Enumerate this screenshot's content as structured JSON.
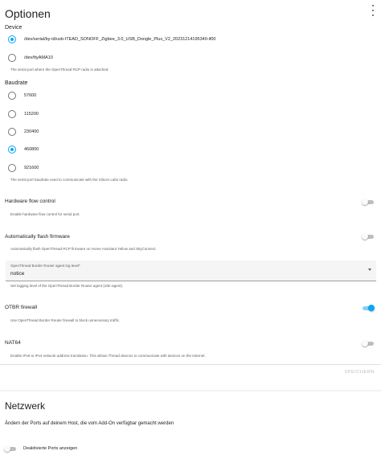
{
  "options_card": {
    "title": "Optionen",
    "device": {
      "label": "Device",
      "options": [
        {
          "label": "/dev/serial/by-id/usb-ITEAD_SONOFF_Zigbee_3.0_USB_Dongle_Plus_V2_20231214195340-if00",
          "selected": true
        },
        {
          "label": "/dev/ttyAMA10",
          "selected": false
        }
      ],
      "helper": "The serial port where the OpenThread RCP radio is attached."
    },
    "baudrate": {
      "label": "Baudrate",
      "options": [
        {
          "label": "57600",
          "selected": false
        },
        {
          "label": "115200",
          "selected": false
        },
        {
          "label": "230400",
          "selected": false
        },
        {
          "label": "460800",
          "selected": true
        },
        {
          "label": "921600",
          "selected": false
        }
      ],
      "helper": "The serial port baudrate used to communicate with the Silicon Labs radio."
    },
    "hardware_flow_control": {
      "label": "Hardware flow control",
      "helper": "Enable hardware flow control for serial port.",
      "enabled": false
    },
    "auto_flash": {
      "label": "Automatically flash firmware",
      "helper": "Automatically flash OpenThread RCP firmware on Home Assistant Yellow and SkyConnect.",
      "enabled": false
    },
    "log_level": {
      "label": "OpenThread Border Router agent log level*",
      "value": "notice",
      "helper": "Set logging level of the OpenThread Border Router agent (otbr-agent)."
    },
    "otbr_firewall": {
      "label": "OTBR firewall",
      "helper": "Use OpenThread Border Router firewall to block unnecessary traffic.",
      "enabled": true
    },
    "nat64": {
      "label": "NAT64",
      "helper": "Enable IPv6 to IPv4 network address translation. This allows Thread devices to communicate with devices on the Internet.",
      "enabled": false
    },
    "save_label": "SPEICHERN"
  },
  "network_card": {
    "title": "Netzwerk",
    "description": "Ändern der Ports auf deinem Host, die vom Add-On verfügbar gemacht werden",
    "show_disabled_ports_label": "Deaktivierte Ports anzeigen",
    "show_disabled_ports": false
  },
  "colors": {
    "accent": "#03a9f4",
    "accent_track": "#81d4fa",
    "text": "#212121",
    "secondary_text": "#616161",
    "disabled": "#bdbdbd"
  },
  "icons": {
    "menu": "overflow-menu-icon",
    "dropdown": "chevron-down-icon"
  }
}
